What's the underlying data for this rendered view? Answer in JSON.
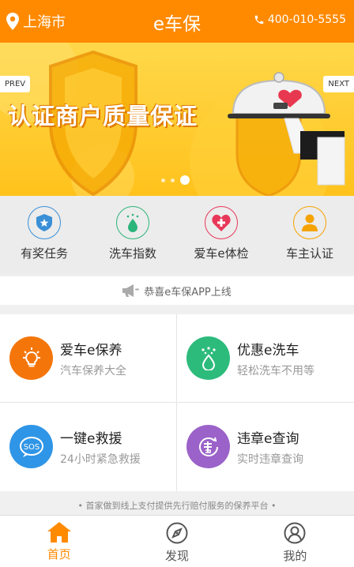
{
  "header": {
    "city": "上海市",
    "title": "e车保",
    "phone": "400-010-5555"
  },
  "banner": {
    "headline": "认证商户质量保证",
    "prev_label": "PREV",
    "next_label": "NEXT",
    "slide_count": 3,
    "active_slide": 3
  },
  "quick_menu": [
    {
      "label": "有奖任务",
      "icon": "shield-star-icon",
      "color": "#3a8fd6"
    },
    {
      "label": "洗车指数",
      "icon": "water-drop-icon",
      "color": "#2bb57a"
    },
    {
      "label": "爱车e体检",
      "icon": "heart-plus-icon",
      "color": "#e8385a"
    },
    {
      "label": "车主认证",
      "icon": "user-icon",
      "color": "#f5a300"
    }
  ],
  "notice": {
    "text": "恭喜e车保APP上线",
    "icon": "megaphone-icon"
  },
  "services": [
    {
      "title": "爱车e保养",
      "subtitle": "汽车保养大全",
      "icon": "bulb-icon",
      "color": "#f4760b"
    },
    {
      "title": "优惠e洗车",
      "subtitle": "轻松洗车不用等",
      "icon": "water-drop-icon",
      "color": "#2dbb7c"
    },
    {
      "title": "一键e救援",
      "subtitle": "24小时紧急救援",
      "icon": "sos-icon",
      "color": "#2f95e6"
    },
    {
      "title": "违章e查询",
      "subtitle": "实时违章查询",
      "icon": "violation-icon",
      "color": "#9b62c9"
    }
  ],
  "footer_tip": "• 首家做到线上支付提供先行赔付服务的保养平台 •",
  "bottom_nav": [
    {
      "label": "首页",
      "icon": "home-icon",
      "active": true
    },
    {
      "label": "发现",
      "icon": "compass-icon",
      "active": false
    },
    {
      "label": "我的",
      "icon": "profile-icon",
      "active": false
    }
  ],
  "colors": {
    "accent": "#ff8a00"
  }
}
